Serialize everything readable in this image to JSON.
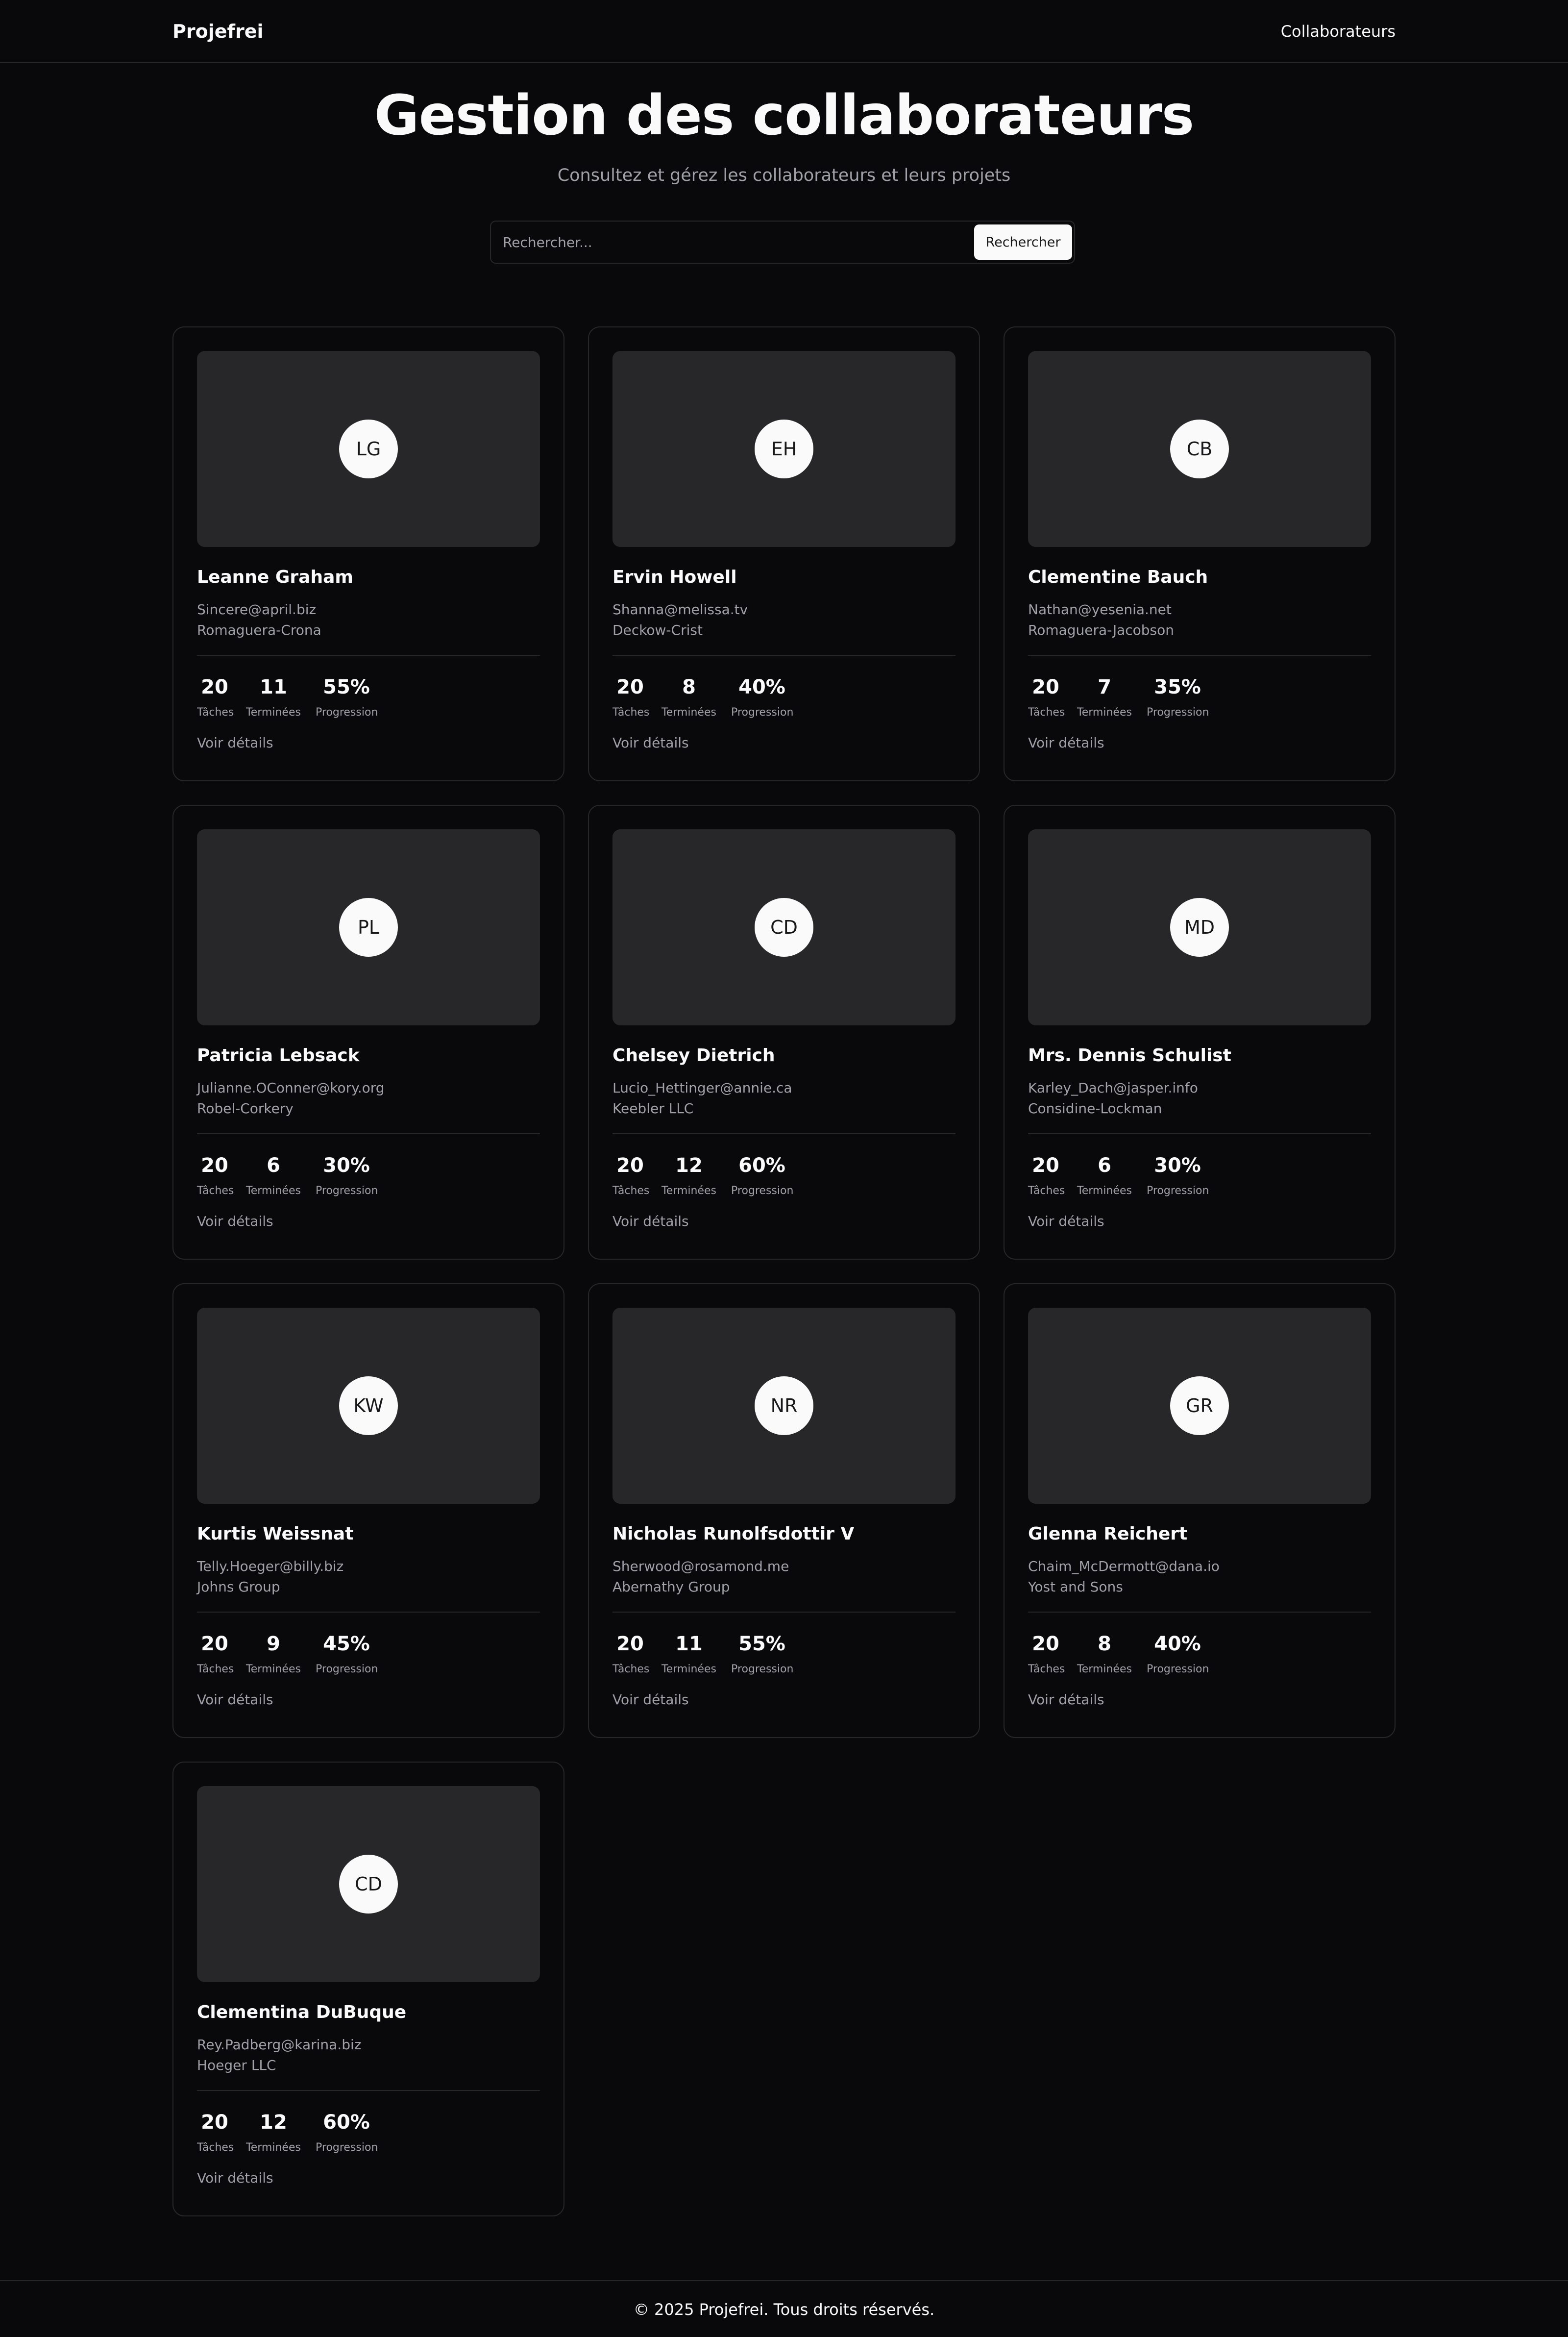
{
  "navbar": {
    "brand": "Projefrei",
    "link": "Collaborateurs"
  },
  "header": {
    "title": "Gestion des collaborateurs",
    "subtitle": "Consultez et gérez les collaborateurs et leurs projets"
  },
  "search": {
    "placeholder": "Rechercher...",
    "value": "",
    "button_label": "Rechercher"
  },
  "stat_labels": {
    "tasks": "Tâches",
    "done": "Terminées",
    "progress": "Progression"
  },
  "details_label": "Voir détails",
  "cards": [
    {
      "initials": "LG",
      "name": "Leanne Graham",
      "email": "Sincere@april.biz",
      "company": "Romaguera-Crona",
      "tasks": "20",
      "done": "11",
      "progress": "55%"
    },
    {
      "initials": "EH",
      "name": "Ervin Howell",
      "email": "Shanna@melissa.tv",
      "company": "Deckow-Crist",
      "tasks": "20",
      "done": "8",
      "progress": "40%"
    },
    {
      "initials": "CB",
      "name": "Clementine Bauch",
      "email": "Nathan@yesenia.net",
      "company": "Romaguera-Jacobson",
      "tasks": "20",
      "done": "7",
      "progress": "35%"
    },
    {
      "initials": "PL",
      "name": "Patricia Lebsack",
      "email": "Julianne.OConner@kory.org",
      "company": "Robel-Corkery",
      "tasks": "20",
      "done": "6",
      "progress": "30%"
    },
    {
      "initials": "CD",
      "name": "Chelsey Dietrich",
      "email": "Lucio_Hettinger@annie.ca",
      "company": "Keebler LLC",
      "tasks": "20",
      "done": "12",
      "progress": "60%"
    },
    {
      "initials": "MD",
      "name": "Mrs. Dennis Schulist",
      "email": "Karley_Dach@jasper.info",
      "company": "Considine-Lockman",
      "tasks": "20",
      "done": "6",
      "progress": "30%"
    },
    {
      "initials": "KW",
      "name": "Kurtis Weissnat",
      "email": "Telly.Hoeger@billy.biz",
      "company": "Johns Group",
      "tasks": "20",
      "done": "9",
      "progress": "45%"
    },
    {
      "initials": "NR",
      "name": "Nicholas Runolfsdottir V",
      "email": "Sherwood@rosamond.me",
      "company": "Abernathy Group",
      "tasks": "20",
      "done": "11",
      "progress": "55%"
    },
    {
      "initials": "GR",
      "name": "Glenna Reichert",
      "email": "Chaim_McDermott@dana.io",
      "company": "Yost and Sons",
      "tasks": "20",
      "done": "8",
      "progress": "40%"
    },
    {
      "initials": "CD",
      "name": "Clementina DuBuque",
      "email": "Rey.Padberg@karina.biz",
      "company": "Hoeger LLC",
      "tasks": "20",
      "done": "12",
      "progress": "60%"
    }
  ],
  "footer": {
    "text": "© 2025 Projefrei. Tous droits réservés."
  },
  "colors": {
    "background": "#09090b",
    "border": "#27272a",
    "foreground": "#fafafa",
    "muted": "#a1a1aa"
  }
}
